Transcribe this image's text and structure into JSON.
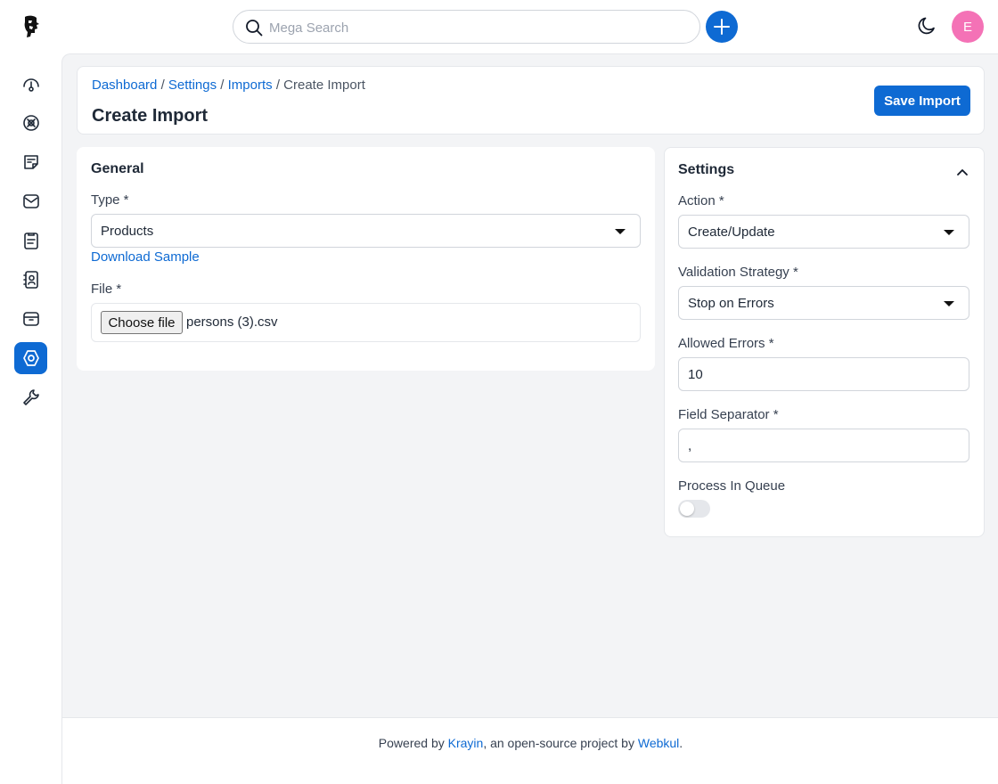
{
  "header": {
    "search_placeholder": "Mega Search",
    "avatar_initial": "E"
  },
  "sidebar": {
    "items": [
      {
        "icon": "dashboard-icon",
        "active": false
      },
      {
        "icon": "leads-icon",
        "active": false
      },
      {
        "icon": "quotes-icon",
        "active": false
      },
      {
        "icon": "mail-icon",
        "active": false
      },
      {
        "icon": "activities-icon",
        "active": false
      },
      {
        "icon": "contacts-icon",
        "active": false
      },
      {
        "icon": "products-icon",
        "active": false
      },
      {
        "icon": "settings-icon",
        "active": true
      },
      {
        "icon": "configuration-icon",
        "active": false
      }
    ]
  },
  "breadcrumb": {
    "dashboard": "Dashboard",
    "settings": "Settings",
    "imports": "Imports",
    "current": "Create Import",
    "separator": "/"
  },
  "page": {
    "title": "Create Import",
    "save_label": "Save Import"
  },
  "general": {
    "title": "General",
    "type_label": "Type *",
    "type_value": "Products",
    "download_label": "Download Sample",
    "file_label": "File *",
    "choose_label": "Choose file",
    "file_name": "persons (3).csv"
  },
  "settings": {
    "title": "Settings",
    "action_label": "Action *",
    "action_value": "Create/Update",
    "validation_label": "Validation Strategy *",
    "validation_value": "Stop on Errors",
    "allowed_errors_label": "Allowed Errors *",
    "allowed_errors_value": "10",
    "separator_label": "Field Separator *",
    "separator_value": ",",
    "queue_label": "Process In Queue",
    "queue_enabled": false
  },
  "footer": {
    "prefix": "Powered by ",
    "krayin": "Krayin",
    "middle": ", an open-source project by ",
    "webkul": "Webkul",
    "suffix": "."
  },
  "colors": {
    "accent": "#0e6ad3",
    "avatar": "#f472b6",
    "background": "#f3f4f6"
  }
}
